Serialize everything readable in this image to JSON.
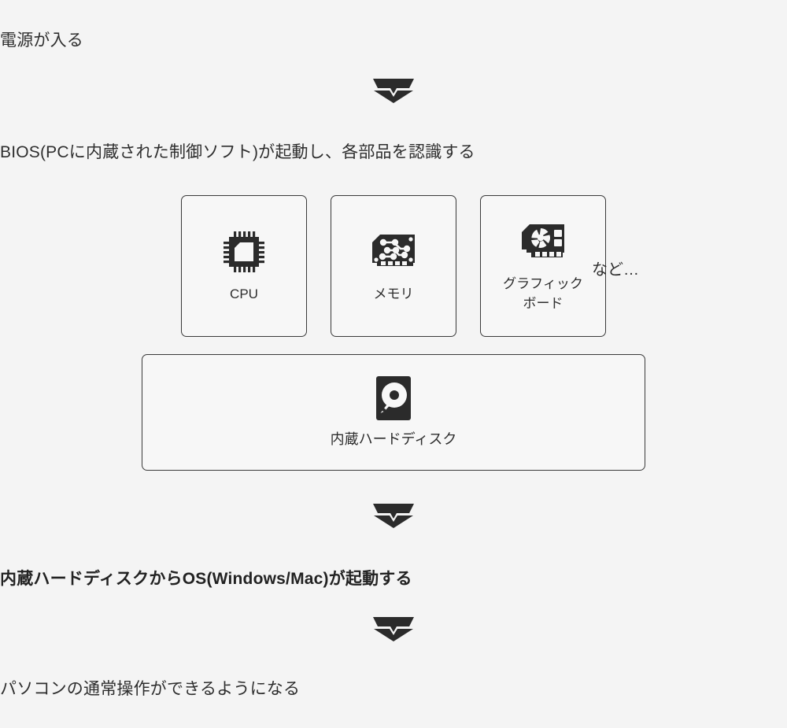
{
  "diagram": {
    "title_step": "電源が入る",
    "background_color": "#f4f4f4",
    "card_fill_color": "#f7f7f7",
    "card_border_color": "#3a3a3a",
    "icon_color": "#2b2b2b",
    "steps": {
      "step1": "電源が入る",
      "step2": "BIOS(PCに内蔵された制御ソフト)が起動し、各部品を認識する",
      "step3": "内蔵ハードディスクからOS(Windows/Mac)が起動する",
      "step4": "パソコンの通常操作ができるようになる"
    },
    "components": [
      {
        "id": "cpu",
        "label": "CPU",
        "icon": "cpu-chip-icon"
      },
      {
        "id": "memory",
        "label": "メモリ",
        "icon": "memory-module-icon"
      },
      {
        "id": "graphics",
        "label": "グラフィック\nボード",
        "icon": "graphics-card-icon"
      }
    ],
    "etc_note": "など…",
    "storage": {
      "label": "内蔵ハードディスク",
      "icon": "hard-disk-icon"
    },
    "arrows": {
      "icon": "chevron-down-arrow",
      "count": 3
    }
  }
}
